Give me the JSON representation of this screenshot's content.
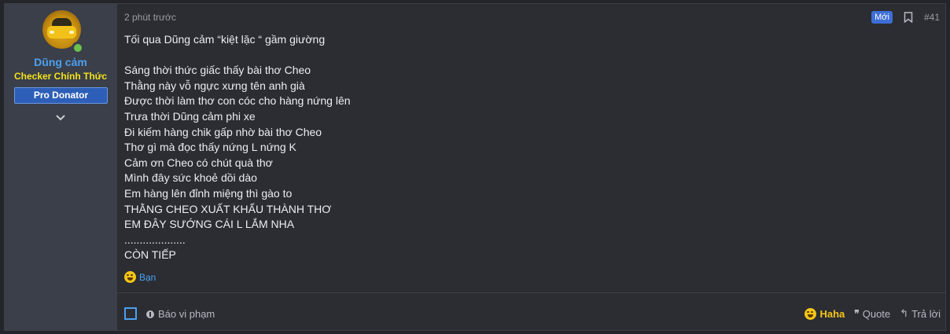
{
  "user": {
    "name": "Dũng cảm",
    "title": "Checker Chính Thức",
    "banner": "Pro Donator"
  },
  "post": {
    "time": "2 phút trước",
    "new_badge": "Mới",
    "number": "#41",
    "body": "Tối qua Dũng cảm “kiệt lặc “ gầm giường\n\nSáng thời thức giấc thấy bài thơ Cheo\nThằng này vỗ ngực xưng tên anh già\nĐược thời làm thơ con cóc cho hàng nứng lên\nTrưa thời Dũng cảm phi xe\nĐi kiếm hàng chik gấp nhờ bài thơ Cheo\nThơ gì mà đọc thấy nứng L nứng K\nCảm ơn Cheo có chút quà thơ\nMình đây sức khoẻ dồi dào\nEm hàng lên đỉnh miệng thì gào to\nTHẰNG CHEO XUẤT KHẨU THÀNH THƠ\nEM ĐÂY SƯỚNG CÁI L LẮM NHA\n....................\nCÒN TIẾP",
    "reaction_by": "Bạn"
  },
  "footer": {
    "report_label": "Báo vi phạm",
    "haha_label": "Haha",
    "quote_label": "Quote",
    "reply_label": "Trả lời"
  },
  "colors": {
    "accent": "#4da0ef",
    "title_yellow": "#f5e11a",
    "banner_bg": "#2e5fb8",
    "new_badge": "#3d6fd6"
  },
  "icons": [
    "online-status-icon",
    "chevron-down-icon",
    "bookmark-icon",
    "haha-emoji-icon",
    "info-icon",
    "quote-icon",
    "reply-icon"
  ]
}
